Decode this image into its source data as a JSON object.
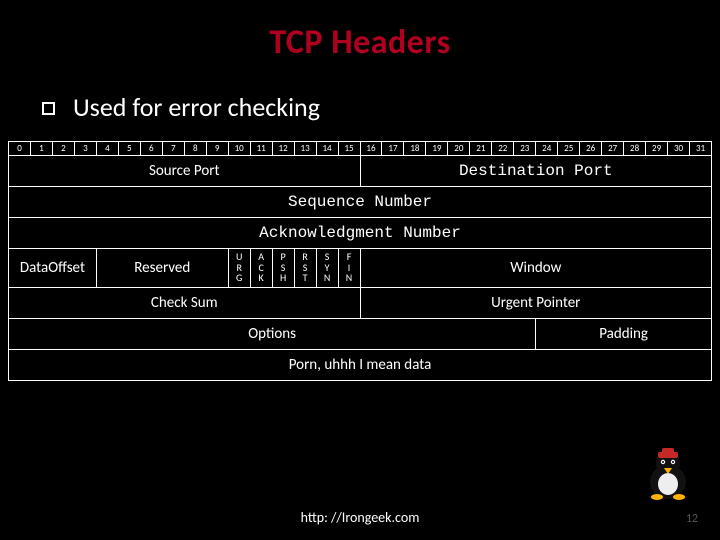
{
  "title": "TCP Headers",
  "bullet": "Used for error checking",
  "bits": [
    "0",
    "1",
    "2",
    "3",
    "4",
    "5",
    "6",
    "7",
    "8",
    "9",
    "1\n0",
    "1\n1",
    "1\n2",
    "1\n3",
    "1\n4",
    "1\n5",
    "1\n6",
    "1\n7",
    "1\n8",
    "1\n9",
    "2\n0",
    "2\n1",
    "2\n2",
    "2\n3",
    "2\n4",
    "2\n5",
    "2\n6",
    "2\n7",
    "2\n8",
    "2\n9",
    "3\n0",
    "3\n1"
  ],
  "rows": {
    "source_port": "Source Port",
    "dest_port": "Destination Port",
    "seq": "Sequence Number",
    "ack": "Acknowledgment Number",
    "data_offset": "Data\nOffset",
    "reserved": "Reserved",
    "flags": [
      "U\nR\nG",
      "A\nC\nK",
      "P\nS\nH",
      "R\nS\nT",
      "S\nY\nN",
      "F\nI\nN"
    ],
    "window": "Window",
    "checksum": "Check Sum",
    "urgent": "Urgent Pointer",
    "options": "Options",
    "padding": "Padding",
    "data": "Porn, uhhh I mean data"
  },
  "footer": "http: //Irongeek.com",
  "slide_number": "12"
}
